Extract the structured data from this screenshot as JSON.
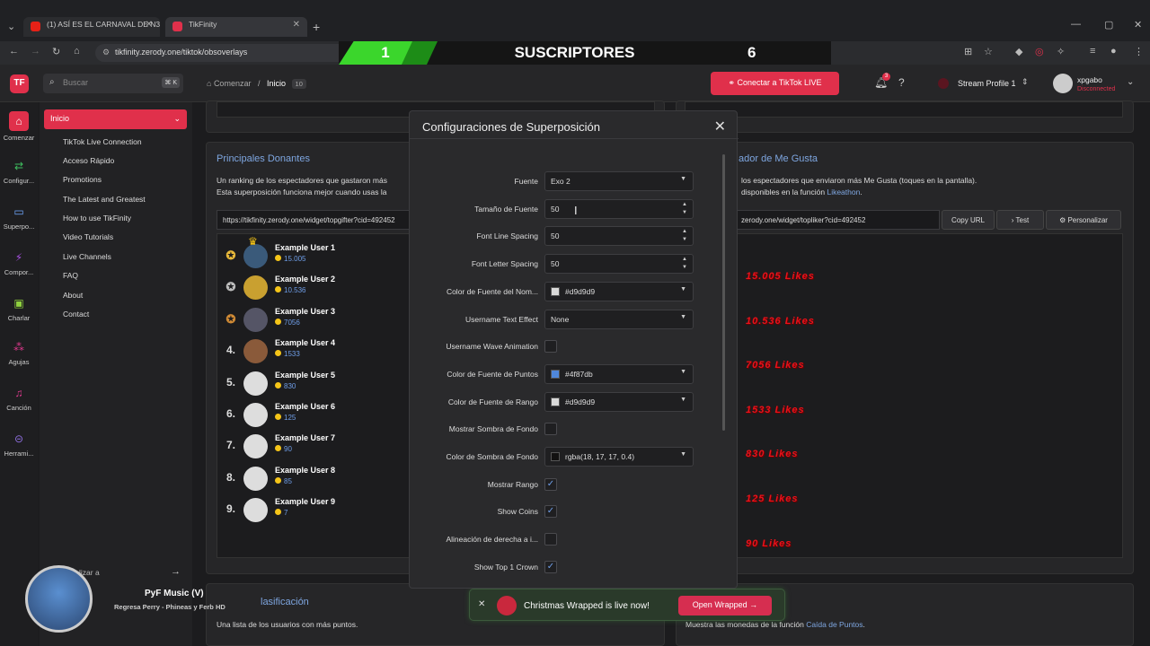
{
  "browser": {
    "tabs": [
      {
        "title": "(1) ASÍ ES EL CARNAVAL DE N3..."
      },
      {
        "title": "TikFinity"
      }
    ],
    "url": "tikfinity.zerody.one/tiktok/obsoverlays"
  },
  "banner": {
    "left_number": "1",
    "title": "SUSCRIPTORES",
    "right_number": "6"
  },
  "header": {
    "search_placeholder": "Buscar",
    "search_shortcut": "⌘ K",
    "breadcrumb_home": "Comenzar",
    "breadcrumb_sep": "/",
    "breadcrumb_current": "Inicio",
    "breadcrumb_count": "10",
    "connect_label": "Conectar a TikTok LIVE",
    "notif_count": "3",
    "stream_profile": "Stream Profile 1",
    "user_name": "xpgabo",
    "user_status": "Disconnected"
  },
  "rail": [
    {
      "label": "Comenzar"
    },
    {
      "label": "Configur..."
    },
    {
      "label": "Superpo..."
    },
    {
      "label": "Compor..."
    },
    {
      "label": "Charlar"
    },
    {
      "label": "Agujas"
    },
    {
      "label": "Canción"
    },
    {
      "label": "Herrami..."
    }
  ],
  "nav": {
    "head": "Inicio",
    "links": [
      "TikTok Live Connection",
      "Acceso Rápido",
      "Promotions",
      "The Latest and Greatest",
      "How to use TikFinity",
      "Video Tutorials",
      "Live Channels",
      "FAQ",
      "About",
      "Contact"
    ]
  },
  "left_card": {
    "title": "Principales Donantes",
    "desc1": "Un ranking de los espectadores que gastaron más",
    "desc2": "Esta superposición funciona mejor cuando usas la",
    "url": "https://tikfinity.zerody.one/widget/topgifter?cid=492452",
    "donors": [
      {
        "rank": "",
        "name": "Example User 1",
        "coins": "15.005"
      },
      {
        "rank": "",
        "name": "Example User 2",
        "coins": "10.536"
      },
      {
        "rank": "",
        "name": "Example User 3",
        "coins": "7056"
      },
      {
        "rank": "4.",
        "name": "Example User 4",
        "coins": "1533"
      },
      {
        "rank": "5.",
        "name": "Example User 5",
        "coins": "830"
      },
      {
        "rank": "6.",
        "name": "Example User 6",
        "coins": "125"
      },
      {
        "rank": "7.",
        "name": "Example User 7",
        "coins": "90"
      },
      {
        "rank": "8.",
        "name": "Example User 8",
        "coins": "85"
      },
      {
        "rank": "9.",
        "name": "Example User 9",
        "coins": "7"
      }
    ]
  },
  "right_card": {
    "title": "ador de Me Gusta",
    "desc1": "los espectadores que enviaron más Me Gusta (toques en la pantalla).",
    "desc2_prefix": "disponibles en la función ",
    "desc2_link": "Likeathon",
    "desc2_suffix": ".",
    "url": "zerody.one/widget/topliker?cid=492452",
    "copy_label": "Copy URL",
    "test_label": "Test",
    "custom_label": "Personalizar",
    "likes": [
      "15.005 Likes",
      "10.536 Likes",
      "7056 Likes",
      "1533 Likes",
      "830 Likes",
      "125 Likes",
      "90 Likes"
    ]
  },
  "modal": {
    "title": "Configuraciones de Superposición",
    "fields": [
      {
        "label": "Fuente",
        "value": "Exo 2",
        "kind": "select"
      },
      {
        "label": "Tamaño de Fuente",
        "value": "50",
        "kind": "number"
      },
      {
        "label": "Font Line Spacing",
        "value": "50",
        "kind": "number"
      },
      {
        "label": "Font Letter Spacing",
        "value": "50",
        "kind": "number"
      },
      {
        "label": "Color de Fuente del Nom...",
        "value": "#d9d9d9",
        "kind": "color",
        "swatch": "#d9d9d9"
      },
      {
        "label": "Username Text Effect",
        "value": "None",
        "kind": "select"
      },
      {
        "label": "Username Wave Animation",
        "value": "",
        "kind": "check",
        "checked": false
      },
      {
        "label": "Color de Fuente de Puntos",
        "value": "#4f87db",
        "kind": "color",
        "swatch": "#4f87db"
      },
      {
        "label": "Color de Fuente de Rango",
        "value": "#d9d9d9",
        "kind": "color",
        "swatch": "#d9d9d9"
      },
      {
        "label": "Mostrar Sombra de Fondo",
        "value": "",
        "kind": "check",
        "checked": false
      },
      {
        "label": "Color de Sombra de Fondo",
        "value": "rgba(18, 17, 17, 0.4)",
        "kind": "color",
        "swatch": "#121111"
      },
      {
        "label": "Mostrar Rango",
        "value": "",
        "kind": "check",
        "checked": true
      },
      {
        "label": "Show Coins",
        "value": "",
        "kind": "check",
        "checked": true
      },
      {
        "label": "Alineación de derecha a i...",
        "value": "",
        "kind": "check",
        "checked": false
      },
      {
        "label": "Show Top 1 Crown",
        "value": "",
        "kind": "check",
        "checked": true
      }
    ]
  },
  "bottom": {
    "left_section": "lasificación",
    "left_desc": "Una lista de los usuarios con más puntos.",
    "right_desc_prefix": "Muestra las monedas de la función ",
    "right_desc_link": "Caída de Puntos",
    "right_desc_suffix": ".",
    "overlay_text": "lizar a",
    "toast_text": "Christmas Wrapped is live now!",
    "toast_button": "Open Wrapped",
    "music_title": "PyF Music (V)",
    "music_sub": "Regresa Perry - Phineas y Ferb HD"
  },
  "colors": {
    "accent": "#e0304b",
    "link": "#7ea6e0",
    "likes": "#e8121b"
  }
}
